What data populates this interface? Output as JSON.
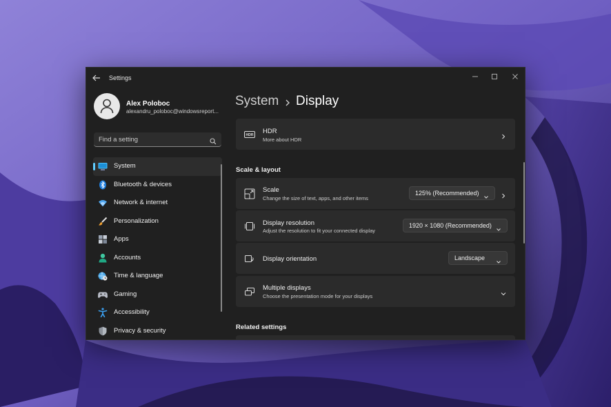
{
  "window": {
    "app_title": "Settings",
    "controls": [
      "minimize-icon",
      "maximize-icon",
      "close-icon"
    ]
  },
  "user": {
    "name": "Alex Poloboc",
    "email": "alexandru_poloboc@windowsreport..."
  },
  "search": {
    "placeholder": "Find a setting"
  },
  "nav": {
    "items": [
      {
        "label": "System",
        "icon": "monitor-icon",
        "active": true
      },
      {
        "label": "Bluetooth & devices",
        "icon": "bluetooth-icon"
      },
      {
        "label": "Network & internet",
        "icon": "wifi-icon"
      },
      {
        "label": "Personalization",
        "icon": "paintbrush-icon"
      },
      {
        "label": "Apps",
        "icon": "apps-icon"
      },
      {
        "label": "Accounts",
        "icon": "person-icon"
      },
      {
        "label": "Time & language",
        "icon": "globe-clock-icon"
      },
      {
        "label": "Gaming",
        "icon": "gamepad-icon"
      },
      {
        "label": "Accessibility",
        "icon": "accessibility-icon"
      },
      {
        "label": "Privacy & security",
        "icon": "shield-icon"
      }
    ]
  },
  "breadcrumb": {
    "parent": "System",
    "current": "Display"
  },
  "hdr": {
    "title": "HDR",
    "subtitle": "More about HDR"
  },
  "scale_layout": {
    "heading": "Scale & layout",
    "scale": {
      "title": "Scale",
      "subtitle": "Change the size of text, apps, and other items",
      "value": "125% (Recommended)"
    },
    "resolution": {
      "title": "Display resolution",
      "subtitle": "Adjust the resolution to fit your connected display",
      "value": "1920 × 1080 (Recommended)"
    },
    "orientation": {
      "title": "Display orientation",
      "value": "Landscape"
    },
    "multiple": {
      "title": "Multiple displays",
      "subtitle": "Choose the presentation mode for your displays"
    }
  },
  "related": {
    "heading": "Related settings"
  },
  "colors": {
    "accent": "#60cdff",
    "window_bg": "#202020",
    "card_bg": "#2b2b2b",
    "wallpaper": "#6a5bb8"
  }
}
